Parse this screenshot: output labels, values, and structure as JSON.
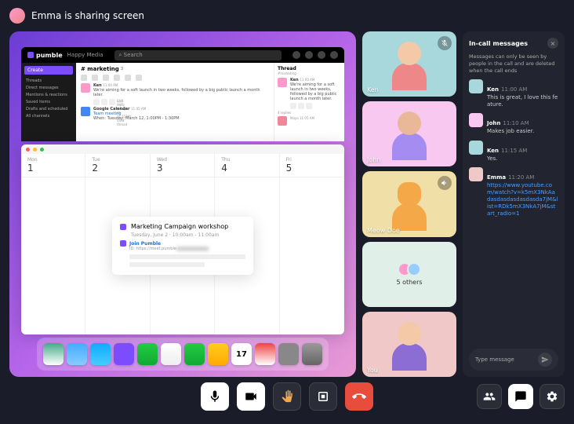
{
  "topbar": {
    "status_text": "Emma is sharing screen"
  },
  "pumble": {
    "logo": "pumble",
    "team": "Happy Media",
    "search_placeholder": "Search",
    "create_label": "Create",
    "sidebar_items": [
      "Threads",
      "Direct messages",
      "Mentions & reactions",
      "Saved items",
      "Drafts and scheduled",
      "All channels"
    ],
    "channel": "# marketing",
    "channel_members": "3",
    "msg1": {
      "name": "Ken",
      "time": "11:00 AM",
      "text": "We're aiming for a soft launch in two weeks, followed by a big public launch a month later."
    },
    "reply_meta": "Last reply today at 11:15AM View thread",
    "msg2": {
      "name": "Google Calendar",
      "time": "11:05 AM",
      "text": "Team meeting",
      "detail": "When: Tuesday, March 12, 1:00PM - 1:30PM"
    },
    "thread": {
      "title": "Thread",
      "sub": "#marketing",
      "name": "Ken",
      "time": "11:00 AM",
      "text": "We're aiming for a soft launch in two weeks, followed by a big public launch a month later.",
      "reply_count": "4 replies",
      "maya": "Maya 11:05 AM"
    }
  },
  "calendar": {
    "days": [
      {
        "dow": "Mon",
        "num": "1"
      },
      {
        "dow": "Tue",
        "num": "2"
      },
      {
        "dow": "Wed",
        "num": "3"
      },
      {
        "dow": "Thu",
        "num": "4"
      },
      {
        "dow": "Fri",
        "num": "5"
      }
    ],
    "event": {
      "title": "Marketing Campaign workshop",
      "time": "Tuesday, June 2 · 10:00am - 11:00am",
      "join_label": "Join Pumble",
      "url_prefix": "ID: https://meet.pumble"
    }
  },
  "participants": [
    {
      "name": "Ken"
    },
    {
      "name": "John"
    },
    {
      "name": "Meow Doe"
    },
    {
      "others": "5 others"
    },
    {
      "name": "You"
    }
  ],
  "chat": {
    "title": "In-call messages",
    "notice": "Messages can only be seen by people in the call and are deleted when the call ends",
    "messages": [
      {
        "name": "Ken",
        "time": "11:00 AM",
        "text": "This is great, I love this feature."
      },
      {
        "name": "John",
        "time": "11:10 AM",
        "text": "Makes job easier."
      },
      {
        "name": "Ken",
        "time": "11:15 AM",
        "text": "Yes."
      },
      {
        "name": "Emma",
        "time": "11:20 AM",
        "link": "https://www.youtube.com/watch?v=k5mX3NkAadasdasdasdasdasda7jM&list=RDk5mX3NkA7jM&start_radio=1"
      }
    ],
    "input_placeholder": "Type message"
  }
}
